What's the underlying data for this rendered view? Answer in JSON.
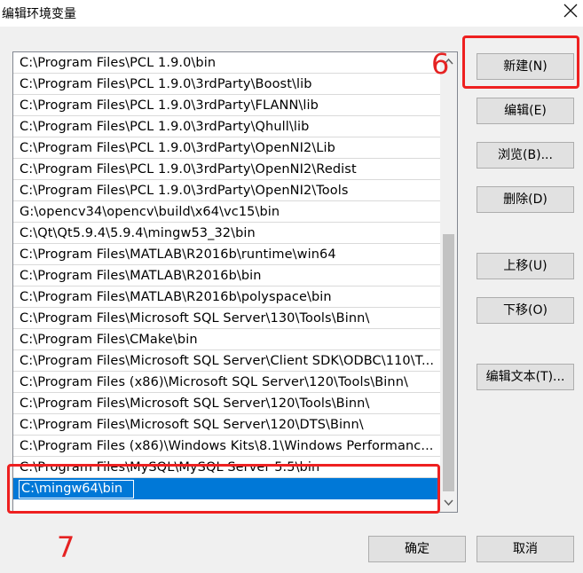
{
  "window": {
    "title": "编辑环境变量"
  },
  "paths": [
    "C:\\Program Files\\PCL 1.9.0\\bin",
    "C:\\Program Files\\PCL 1.9.0\\3rdParty\\Boost\\lib",
    "C:\\Program Files\\PCL 1.9.0\\3rdParty\\FLANN\\lib",
    "C:\\Program Files\\PCL 1.9.0\\3rdParty\\Qhull\\lib",
    "C:\\Program Files\\PCL 1.9.0\\3rdParty\\OpenNI2\\Lib",
    "C:\\Program Files\\PCL 1.9.0\\3rdParty\\OpenNI2\\Redist",
    "C:\\Program Files\\PCL 1.9.0\\3rdParty\\OpenNI2\\Tools",
    "G:\\opencv34\\opencv\\build\\x64\\vc15\\bin",
    "C:\\Qt\\Qt5.9.4\\5.9.4\\mingw53_32\\bin",
    "C:\\Program Files\\MATLAB\\R2016b\\runtime\\win64",
    "C:\\Program Files\\MATLAB\\R2016b\\bin",
    "C:\\Program Files\\MATLAB\\R2016b\\polyspace\\bin",
    "C:\\Program Files\\Microsoft SQL Server\\130\\Tools\\Binn\\",
    "C:\\Program Files\\CMake\\bin",
    "C:\\Program Files\\Microsoft SQL Server\\Client SDK\\ODBC\\110\\T...",
    "C:\\Program Files (x86)\\Microsoft SQL Server\\120\\Tools\\Binn\\",
    "C:\\Program Files\\Microsoft SQL Server\\120\\Tools\\Binn\\",
    "C:\\Program Files\\Microsoft SQL Server\\120\\DTS\\Binn\\",
    "C:\\Program Files (x86)\\Windows Kits\\8.1\\Windows Performanc...",
    "C:\\Program Files\\MySQL\\MySQL Server 5.5\\bin"
  ],
  "editing_value": "C:\\mingw64\\bin",
  "buttons": {
    "new": "新建(N)",
    "edit": "编辑(E)",
    "browse": "浏览(B)...",
    "delete": "删除(D)",
    "move_up": "上移(U)",
    "move_down": "下移(O)",
    "edit_text": "编辑文本(T)...",
    "ok": "确定",
    "cancel": "取消"
  },
  "annotations": {
    "step_new": "6",
    "step_ok": "7"
  },
  "colors": {
    "selection": "#0078d7",
    "highlight": "#ee2020"
  }
}
